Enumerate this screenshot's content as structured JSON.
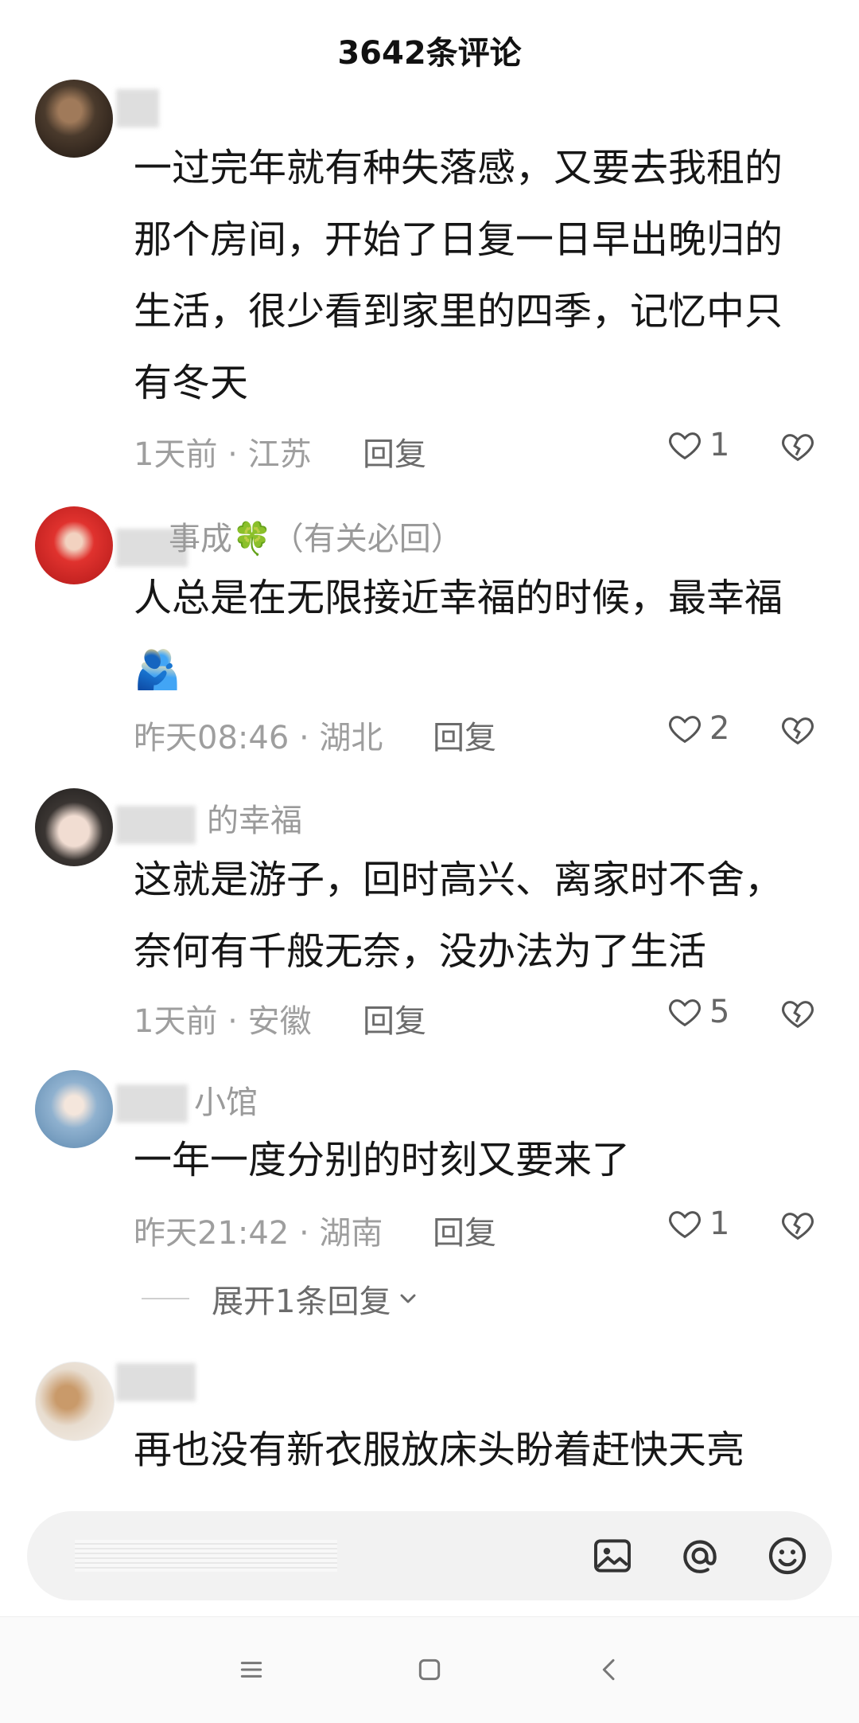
{
  "header": {
    "title": "3642条评论"
  },
  "comments": [
    {
      "username": "",
      "text": "一过完年就有种失落感，又要去我租的那个房间，开始了日复一日早出晚归的生活，很少看到家里的四季，记忆中只有冬天",
      "time_location": "1天前 · 江苏",
      "reply_label": "回复",
      "likes": "1"
    },
    {
      "username": "事成🍀（有关必回）",
      "text": "人总是在无限接近幸福的时候，最幸福🫂",
      "time_location": "昨天08:46 · 湖北",
      "reply_label": "回复",
      "likes": "2"
    },
    {
      "username": "的幸福",
      "text": "这就是游子，回时高兴、离家时不舍，奈何有千般无奈，没办法为了生活",
      "time_location": "1天前 · 安徽",
      "reply_label": "回复",
      "likes": "5"
    },
    {
      "username": "小馆",
      "text": "一年一度分别的时刻又要来了",
      "time_location": "昨天21:42 · 湖南",
      "reply_label": "回复",
      "likes": "1"
    },
    {
      "username": "",
      "text": "再也没有新衣服放床头盼着赶快天亮",
      "time_location": "",
      "reply_label": "",
      "likes": ""
    }
  ],
  "expand_replies": "展开1条回复",
  "input_bar": {
    "icons": [
      "image-icon",
      "at-icon",
      "emoji-icon"
    ]
  },
  "nav_bar": {
    "icons": [
      "menu-icon",
      "home-icon",
      "back-icon"
    ]
  },
  "colors": {
    "text": "#161616",
    "meta": "#9e9e9e",
    "input_bg": "#f2f2f2"
  }
}
